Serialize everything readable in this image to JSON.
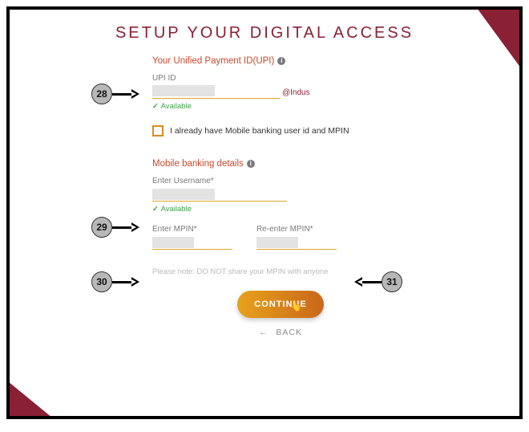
{
  "title": "SETUP YOUR DIGITAL ACCESS",
  "upi": {
    "section_label": "Your Unified Payment ID(UPI)",
    "field_label": "UPI ID",
    "suffix": "@Indus",
    "available": "Available"
  },
  "checkbox": {
    "label": "I already have Mobile banking user id and MPIN"
  },
  "mobile": {
    "section_label": "Mobile banking details",
    "username_label": "Enter Username*",
    "available": "Available",
    "mpin_label": "Enter MPIN*",
    "rempin_label": "Re-enter MPIN*"
  },
  "note": "Please note: DO NOT share your MPIN with anyone",
  "continue_label": "CONTINUE",
  "back_label": "BACK",
  "callouts": {
    "a": "28",
    "b": "29",
    "c": "30",
    "d": "31"
  }
}
